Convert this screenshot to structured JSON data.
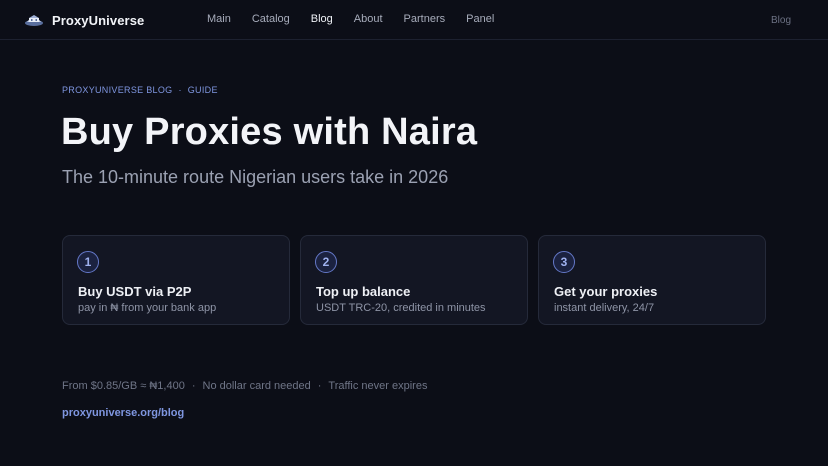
{
  "header": {
    "brand_name": "ProxyUniverse",
    "logo_icon": "proxyuniverse-logo-icon",
    "nav": [
      {
        "label": "Main"
      },
      {
        "label": "Catalog"
      },
      {
        "label": "Blog",
        "active": true
      },
      {
        "label": "About"
      },
      {
        "label": "Partners"
      },
      {
        "label": "Panel"
      }
    ],
    "right_link": "Blog"
  },
  "hero": {
    "eyebrow_section": "PROXYUNIVERSE BLOG",
    "eyebrow_dot": "·",
    "eyebrow_tag": "GUIDE",
    "title": "Buy Proxies with Naira",
    "subtitle": "The 10-minute route Nigerian users take in 2026"
  },
  "steps": [
    {
      "number": "1",
      "title": "Buy USDT via P2P",
      "desc": "pay in ₦ from your bank app"
    },
    {
      "number": "2",
      "title": "Top up balance",
      "desc": "USDT TRC-20, credited in minutes"
    },
    {
      "number": "3",
      "title": "Get your proxies",
      "desc": "instant delivery, 24/7"
    }
  ],
  "facts": {
    "items": [
      "From $0.85/GB ≈ ₦1,400",
      "No dollar card needed",
      "Traffic never expires"
    ],
    "separator": "·"
  },
  "footer_link": "proxyuniverse.org/blog",
  "colors": {
    "background": "#0c0e17",
    "accent": "#7f96e0",
    "card": "#131623"
  }
}
